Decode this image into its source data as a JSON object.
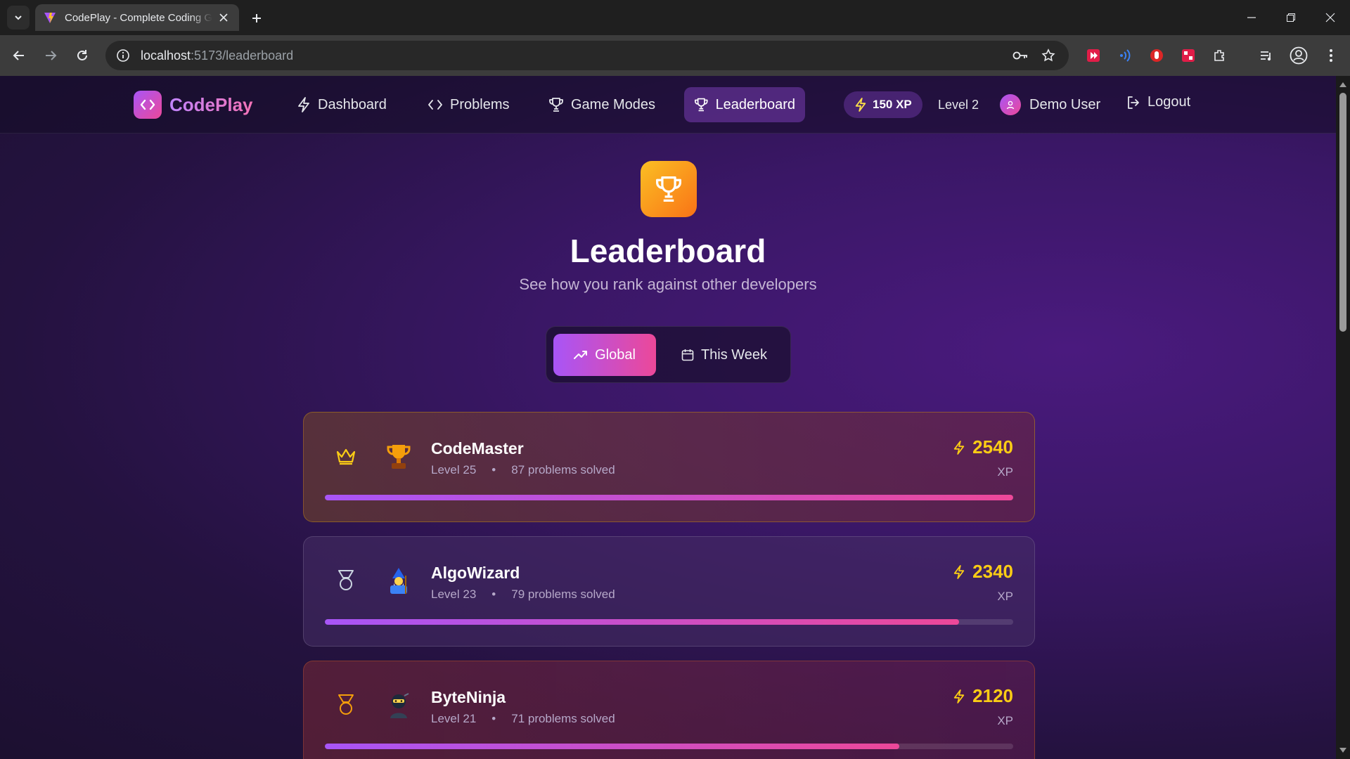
{
  "browser": {
    "tab_title": "CodePlay - Complete Coding G",
    "url_host": "localhost",
    "url_path": ":5173/leaderboard"
  },
  "nav": {
    "logo": "CodePlay",
    "items": [
      {
        "label": "Dashboard",
        "icon": "bolt-icon"
      },
      {
        "label": "Problems",
        "icon": "code-icon"
      },
      {
        "label": "Game Modes",
        "icon": "trophy-icon"
      },
      {
        "label": "Leaderboard",
        "icon": "trophy-icon",
        "active": true
      }
    ],
    "xp": "150 XP",
    "level": "Level 2",
    "user": "Demo User",
    "logout": "Logout"
  },
  "header": {
    "title": "Leaderboard",
    "subtitle": "See how you rank against other developers"
  },
  "toggle": {
    "global": "Global",
    "week": "This Week",
    "selected": "Global"
  },
  "leaderboard": [
    {
      "rank_icon": "crown-icon",
      "avatar": "🏆",
      "name": "CodeMaster",
      "level": "Level 25",
      "solved": "87 problems solved",
      "xp": "2540",
      "xp_unit": "XP",
      "progress": 1.0
    },
    {
      "rank_icon": "medal-silver-icon",
      "avatar": "🧙",
      "name": "AlgoWizard",
      "level": "Level 23",
      "solved": "79 problems solved",
      "xp": "2340",
      "xp_unit": "XP",
      "progress": 0.921
    },
    {
      "rank_icon": "medal-bronze-icon",
      "avatar": "🥷",
      "name": "ByteNinja",
      "level": "Level 21",
      "solved": "71 problems solved",
      "xp": "2120",
      "xp_unit": "XP",
      "progress": 0.835
    }
  ],
  "colors": {
    "accent_from": "#a855f7",
    "accent_to": "#ec4899",
    "xp_yellow": "#facc15",
    "gold": "#fbbf24"
  }
}
